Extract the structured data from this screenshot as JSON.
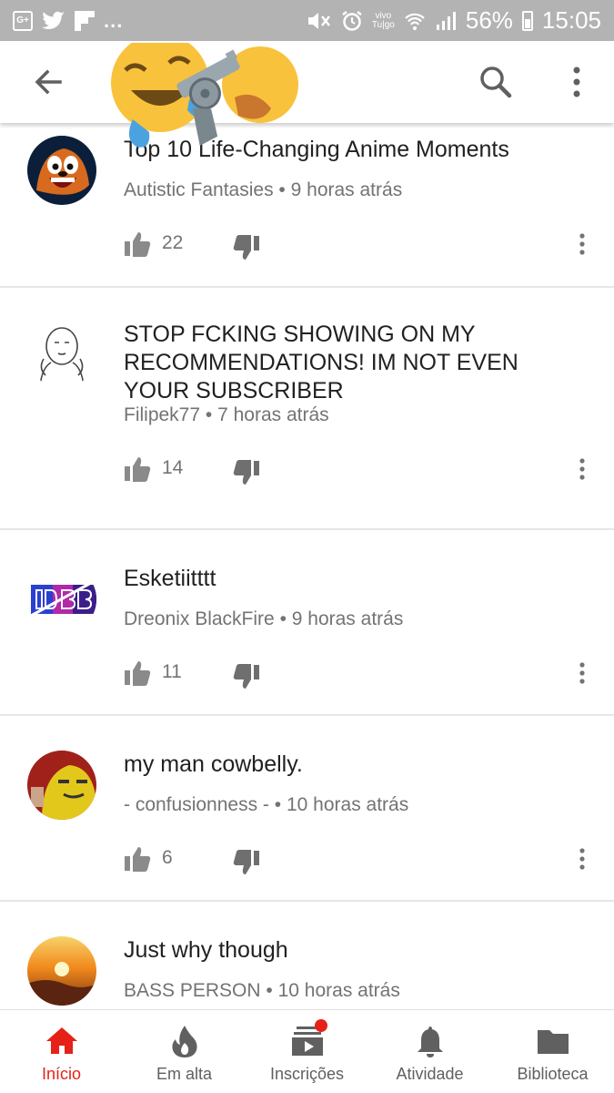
{
  "status_bar": {
    "carrier": "vivo",
    "carrier_sub": "Tu|go",
    "battery": "56%",
    "time": "15:05",
    "overflow": "..."
  },
  "app_bar": {
    "icons": [
      "back-arrow-icon",
      "emoji-crying-laughing-icon",
      "revolver-icon",
      "emoji-hand-icon",
      "search-icon",
      "more-vert-icon"
    ]
  },
  "comments": [
    {
      "title": "Top 10 Life-Changing Anime Moments",
      "author": "Autistic Fantasies",
      "time": "9 horas atrás",
      "likes": "22",
      "avatar": "bandicoot-avatar"
    },
    {
      "title": "STOP FCKING SHOWING ON MY RECOMMENDATIONS! IM NOT EVEN YOUR SUBSCRIBER",
      "author": "Filipek77",
      "time": "7 horas atrás",
      "likes": "14",
      "avatar": "meme-face-avatar"
    },
    {
      "title": "Esketiitttt",
      "author": "Dreonix BlackFire",
      "time": "9 horas atrás",
      "likes": "11",
      "avatar": "db-logo-avatar"
    },
    {
      "title": "my man cowbelly.",
      "author": "- confusionness -",
      "time": "10 horas atrás",
      "likes": "6",
      "avatar": "cartoon-avatar"
    },
    {
      "title": "Just why though",
      "author": "BASS PERSON",
      "time": "10 horas atrás",
      "likes": "",
      "avatar": "sunset-avatar"
    }
  ],
  "separator": "•",
  "bottom_nav": [
    {
      "label": "Início",
      "icon": "home-icon",
      "active": true
    },
    {
      "label": "Em alta",
      "icon": "flame-icon",
      "active": false
    },
    {
      "label": "Inscrições",
      "icon": "subscriptions-icon",
      "active": false
    },
    {
      "label": "Atividade",
      "icon": "bell-icon",
      "active": false
    },
    {
      "label": "Biblioteca",
      "icon": "folder-icon",
      "active": false
    }
  ],
  "colors": {
    "accent": "#e62117",
    "status_bar": "#b3b3b3",
    "icon_gray": "#606060",
    "meta_text": "#737373"
  }
}
